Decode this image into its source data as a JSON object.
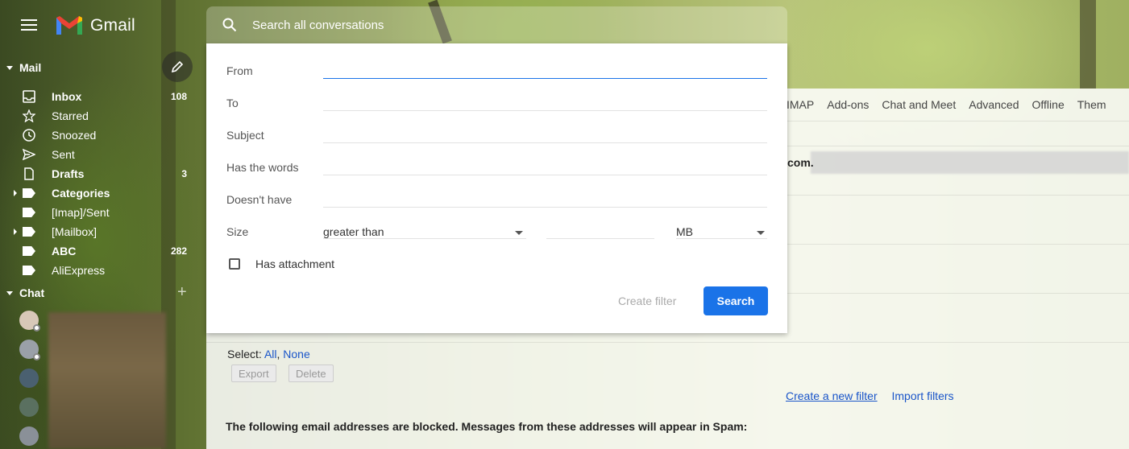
{
  "app": {
    "name": "Gmail"
  },
  "search": {
    "placeholder": "Search all conversations"
  },
  "sidebar": {
    "mail_heading": "Mail",
    "chat_heading": "Chat",
    "items": [
      {
        "label": "Inbox",
        "count": "108",
        "bold": true,
        "icon": "inbox-icon"
      },
      {
        "label": "Starred",
        "count": "",
        "bold": false,
        "icon": "star-icon"
      },
      {
        "label": "Snoozed",
        "count": "",
        "bold": false,
        "icon": "clock-icon"
      },
      {
        "label": "Sent",
        "count": "",
        "bold": false,
        "icon": "send-icon"
      },
      {
        "label": "Drafts",
        "count": "3",
        "bold": true,
        "icon": "draft-icon"
      },
      {
        "label": "Categories",
        "count": "",
        "bold": true,
        "icon": "label-icon"
      },
      {
        "label": "[Imap]/Sent",
        "count": "",
        "bold": false,
        "icon": "label-icon"
      },
      {
        "label": "[Mailbox]",
        "count": "",
        "bold": false,
        "icon": "label-icon"
      },
      {
        "label": "ABC",
        "count": "282",
        "bold": true,
        "icon": "label-icon"
      },
      {
        "label": "AliExpress",
        "count": "",
        "bold": false,
        "icon": "label-icon"
      }
    ]
  },
  "tabs": [
    "IMAP",
    "Add-ons",
    "Chat and Meet",
    "Advanced",
    "Offline",
    "Them"
  ],
  "filter_panel": {
    "from_label": "From",
    "to_label": "To",
    "subject_label": "Subject",
    "has_words_label": "Has the words",
    "doesnt_have_label": "Doesn't have",
    "size_label": "Size",
    "size_operator": "greater than",
    "size_unit": "MB",
    "has_attachment_label": "Has attachment",
    "create_filter_label": "Create filter",
    "search_label": "Search"
  },
  "settings": {
    "email_fragment": "com.",
    "select_label": "Select:",
    "select_all": "All",
    "select_none": "None",
    "export_label": "Export",
    "delete_label": "Delete",
    "create_new_filter": "Create a new filter",
    "import_filters": "Import filters",
    "blocked_text": "The following email addresses are blocked. Messages from these addresses will appear in Spam:"
  },
  "colors": {
    "accent": "#1a73e8",
    "link": "#1a55c9"
  }
}
